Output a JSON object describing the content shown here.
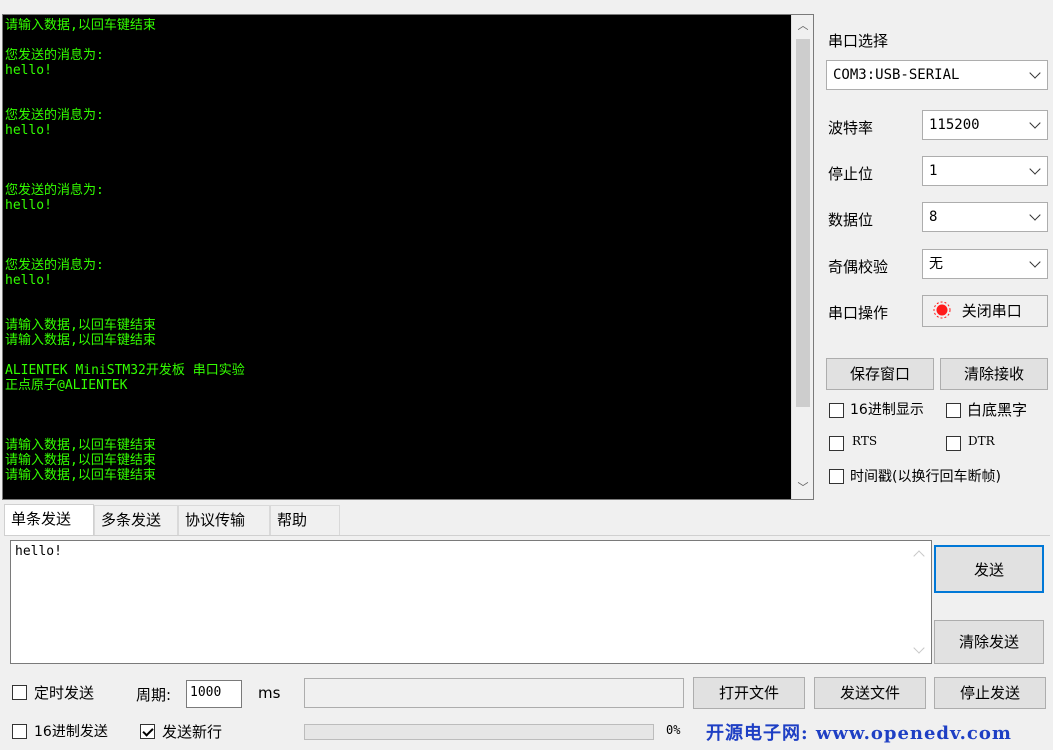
{
  "terminal": {
    "lines": [
      "请输入数据,以回车键结束",
      "",
      "您发送的消息为:",
      "hello!",
      "",
      "",
      "您发送的消息为:",
      "hello!",
      "",
      "",
      "",
      "您发送的消息为:",
      "hello!",
      "",
      "",
      "",
      "您发送的消息为:",
      "hello!",
      "",
      "",
      "请输入数据,以回车键结束",
      "请输入数据,以回车键结束",
      "",
      "ALIENTEK MiniSTM32开发板 串口实验",
      "正点原子@ALIENTEK",
      "",
      "",
      "",
      "请输入数据,以回车键结束",
      "请输入数据,以回车键结束",
      "请输入数据,以回车键结束"
    ]
  },
  "settings": {
    "port_select_label": "串口选择",
    "port_value": "COM3:USB-SERIAL",
    "baud_label": "波特率",
    "baud_value": "115200",
    "stopbits_label": "停止位",
    "stopbits_value": "1",
    "databits_label": "数据位",
    "databits_value": "8",
    "parity_label": "奇偶校验",
    "parity_value": "无",
    "port_op_label": "串口操作",
    "close_port_label": "关闭串口",
    "status_color": "#ff0000",
    "save_window_label": "保存窗口",
    "clear_receive_label": "清除接收",
    "hex_display_label": "16进制显示",
    "white_bg_label": "白底黑字",
    "rts_label": "RTS",
    "dtr_label": "DTR",
    "timestamp_label": "时间戳(以换行回车断帧)"
  },
  "tabs": [
    "单条发送",
    "多条发送",
    "协议传输",
    "帮助"
  ],
  "send": {
    "text": "hello!",
    "send_label": "发送",
    "clear_send_label": "清除发送",
    "timed_send_label": "定时发送",
    "period_label": "周期:",
    "period_value": "1000",
    "period_unit": "ms",
    "open_file_label": "打开文件",
    "send_file_label": "发送文件",
    "stop_send_label": "停止发送",
    "hex_send_label": "16进制发送",
    "send_newline_label": "发送新行",
    "newline_checked": true,
    "progress_text": "0%",
    "progress": 0
  },
  "footer": {
    "watermark": "开源电子网: www.openedv.com"
  }
}
